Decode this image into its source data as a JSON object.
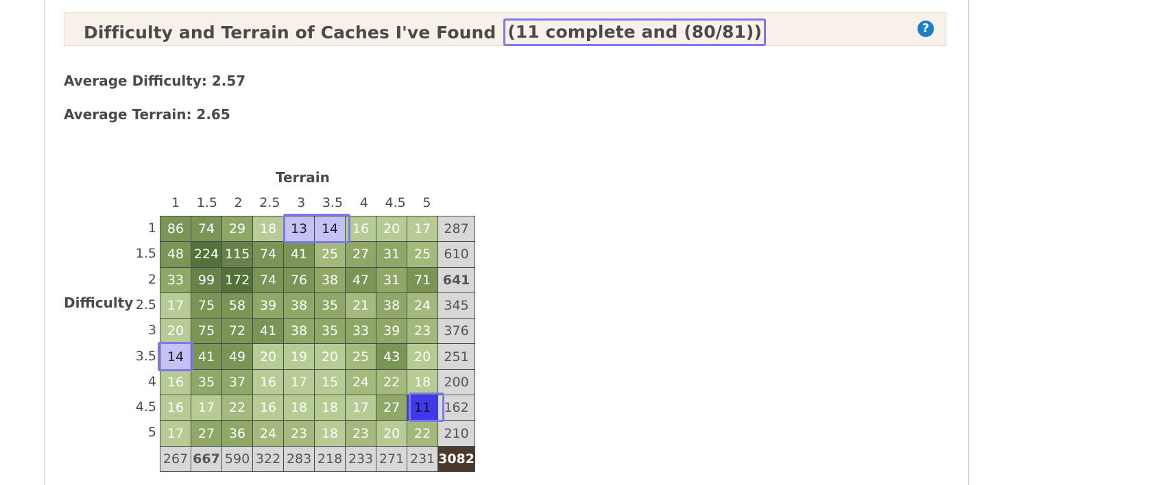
{
  "header": {
    "title": "Difficulty and Terrain of Caches I've Found",
    "highlight": "(11 complete and (80/81))",
    "help_icon": "question-circle-icon"
  },
  "stats": {
    "avg_difficulty": "Average Difficulty: 2.57",
    "avg_terrain": "Average Terrain: 2.65"
  },
  "axis": {
    "terrain_label": "Terrain",
    "difficulty_label": "Difficulty"
  },
  "colors": {
    "scale": [
      "#b7cb95",
      "#a4ba7d",
      "#8fa868",
      "#7b9556",
      "#69824a",
      "#55723a"
    ],
    "found": "#c4c2f5",
    "found_complete": "#3e3aeb",
    "highlight": "#7b78f0",
    "total": "#d8d8d8",
    "grand": "#4a3a2e"
  },
  "grid": {
    "terrain": [
      "1",
      "1.5",
      "2",
      "2.5",
      "3",
      "3.5",
      "4",
      "4.5",
      "5"
    ],
    "difficulty": [
      "1",
      "1.5",
      "2",
      "2.5",
      "3",
      "3.5",
      "4",
      "4.5",
      "5"
    ],
    "rows": [
      [
        86,
        74,
        29,
        18,
        13,
        14,
        16,
        20,
        17
      ],
      [
        48,
        224,
        115,
        74,
        41,
        25,
        27,
        31,
        25
      ],
      [
        33,
        99,
        172,
        74,
        76,
        38,
        47,
        31,
        71
      ],
      [
        17,
        75,
        58,
        39,
        38,
        35,
        21,
        38,
        24
      ],
      [
        20,
        75,
        72,
        41,
        38,
        35,
        33,
        39,
        23
      ],
      [
        14,
        41,
        49,
        20,
        19,
        20,
        25,
        43,
        20
      ],
      [
        16,
        35,
        37,
        16,
        17,
        15,
        24,
        22,
        18
      ],
      [
        16,
        17,
        22,
        16,
        18,
        18,
        17,
        27,
        11
      ],
      [
        17,
        27,
        36,
        24,
        23,
        18,
        23,
        20,
        22
      ]
    ],
    "row_totals": [
      287,
      610,
      641,
      345,
      376,
      251,
      200,
      162,
      210
    ],
    "col_totals": [
      267,
      667,
      590,
      322,
      283,
      218,
      233,
      271,
      231
    ],
    "grand_total": 3082,
    "bold_row_total_index": 2,
    "bold_col_total_index": 1,
    "found_cells": [
      [
        0,
        4
      ],
      [
        0,
        5
      ],
      [
        5,
        0
      ]
    ],
    "found_complete_cells": [
      [
        7,
        8
      ]
    ]
  }
}
